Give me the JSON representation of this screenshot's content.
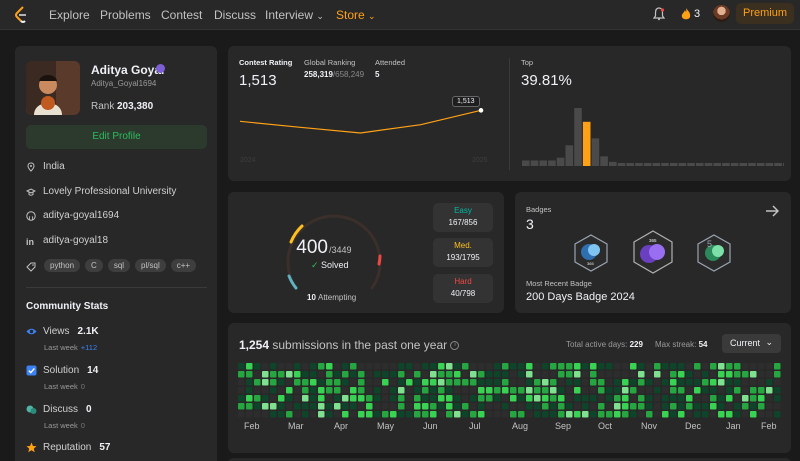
{
  "colors": {
    "accent": "#ffa116",
    "easy": "#00b8a3",
    "medium": "#ffc01e",
    "hard": "#ef4743",
    "green": "#2cbb5d",
    "blue": "#3b82f6"
  },
  "nav": {
    "links": [
      "Explore",
      "Problems",
      "Contest",
      "Discuss",
      "Interview",
      "Store"
    ],
    "streak": "3",
    "premium": "Premium"
  },
  "profile": {
    "name": "Aditya Goyal",
    "handle": "Aditya_Goyal1694",
    "rank_label": "Rank",
    "rank_value": "203,380",
    "edit_label": "Edit Profile",
    "location": "India",
    "school": "Lovely Professional University",
    "github": "aditya-goyal1694",
    "linkedin": "aditya-goyal18",
    "tags": [
      "python",
      "C",
      "sql",
      "pl/sql",
      "c++"
    ]
  },
  "community": {
    "title": "Community Stats",
    "views": {
      "label": "Views",
      "value": "2.1K",
      "last_week_label": "Last week",
      "last_week": "+112"
    },
    "solution": {
      "label": "Solution",
      "value": "14",
      "last_week_label": "Last week",
      "last_week": "0"
    },
    "discuss": {
      "label": "Discuss",
      "value": "0",
      "last_week_label": "Last week",
      "last_week": "0"
    },
    "reputation": {
      "label": "Reputation",
      "value": "57"
    }
  },
  "contest": {
    "rating_label": "Contest Rating",
    "rating": "1,513",
    "global_label": "Global Ranking",
    "global_rank": "258,319",
    "global_total": "/658,249",
    "attended_label": "Attended",
    "attended": "5",
    "tooltip": "1,513",
    "x_start": "2024",
    "x_end": "2025",
    "top_label": "Top",
    "top_value": "39.81%"
  },
  "chart_data": [
    {
      "type": "line",
      "title": "Contest Rating",
      "x": [
        "2024",
        "",
        "",
        "",
        "2025"
      ],
      "values": [
        1480,
        1462,
        1445,
        1470,
        1513
      ],
      "ylim": [
        1400,
        1550
      ]
    },
    {
      "type": "bar",
      "title": "Top",
      "categories": [
        "1",
        "2",
        "3",
        "4",
        "5",
        "6",
        "7",
        "8",
        "9",
        "10",
        "11",
        "12",
        "13",
        "14",
        "15",
        "16",
        "17",
        "18",
        "19",
        "20",
        "21",
        "22",
        "23",
        "24",
        "25",
        "26",
        "27",
        "28",
        "29",
        "30",
        "31"
      ],
      "values": [
        4,
        4,
        4,
        4,
        6,
        15,
        42,
        32,
        20,
        7,
        3,
        1,
        1,
        0.8,
        0.6,
        0.5,
        0.5,
        0.5,
        0.5,
        0.5,
        0.5,
        0.5,
        0.5,
        0.5,
        0.5,
        0.5,
        0.5,
        0.5,
        0.5,
        0.5,
        0.5
      ],
      "highlight_index": 7
    }
  ],
  "solved": {
    "total": "400",
    "out_of": "/3449",
    "solved_label": "Solved",
    "attempting": "10",
    "attempting_label": "Attempting",
    "easy_label": "Easy",
    "easy_value": "167/856",
    "medium_label": "Med.",
    "medium_value": "193/1795",
    "hard_label": "Hard",
    "hard_value": "40/798"
  },
  "badges": {
    "label": "Badges",
    "count": "3",
    "recent_label": "Most Recent Badge",
    "recent_name": "200 Days Badge 2024"
  },
  "submissions": {
    "count": "1,254",
    "title_rest": "submissions in the past one year",
    "active_label": "Total active days:",
    "active_value": "229",
    "streak_label": "Max streak:",
    "streak_value": "54",
    "select_value": "Current",
    "months": [
      "Feb",
      "Mar",
      "Apr",
      "May",
      "Jun",
      "Jul",
      "Aug",
      "Sep",
      "Oct",
      "Nov",
      "Dec",
      "Jan",
      "Feb"
    ]
  }
}
